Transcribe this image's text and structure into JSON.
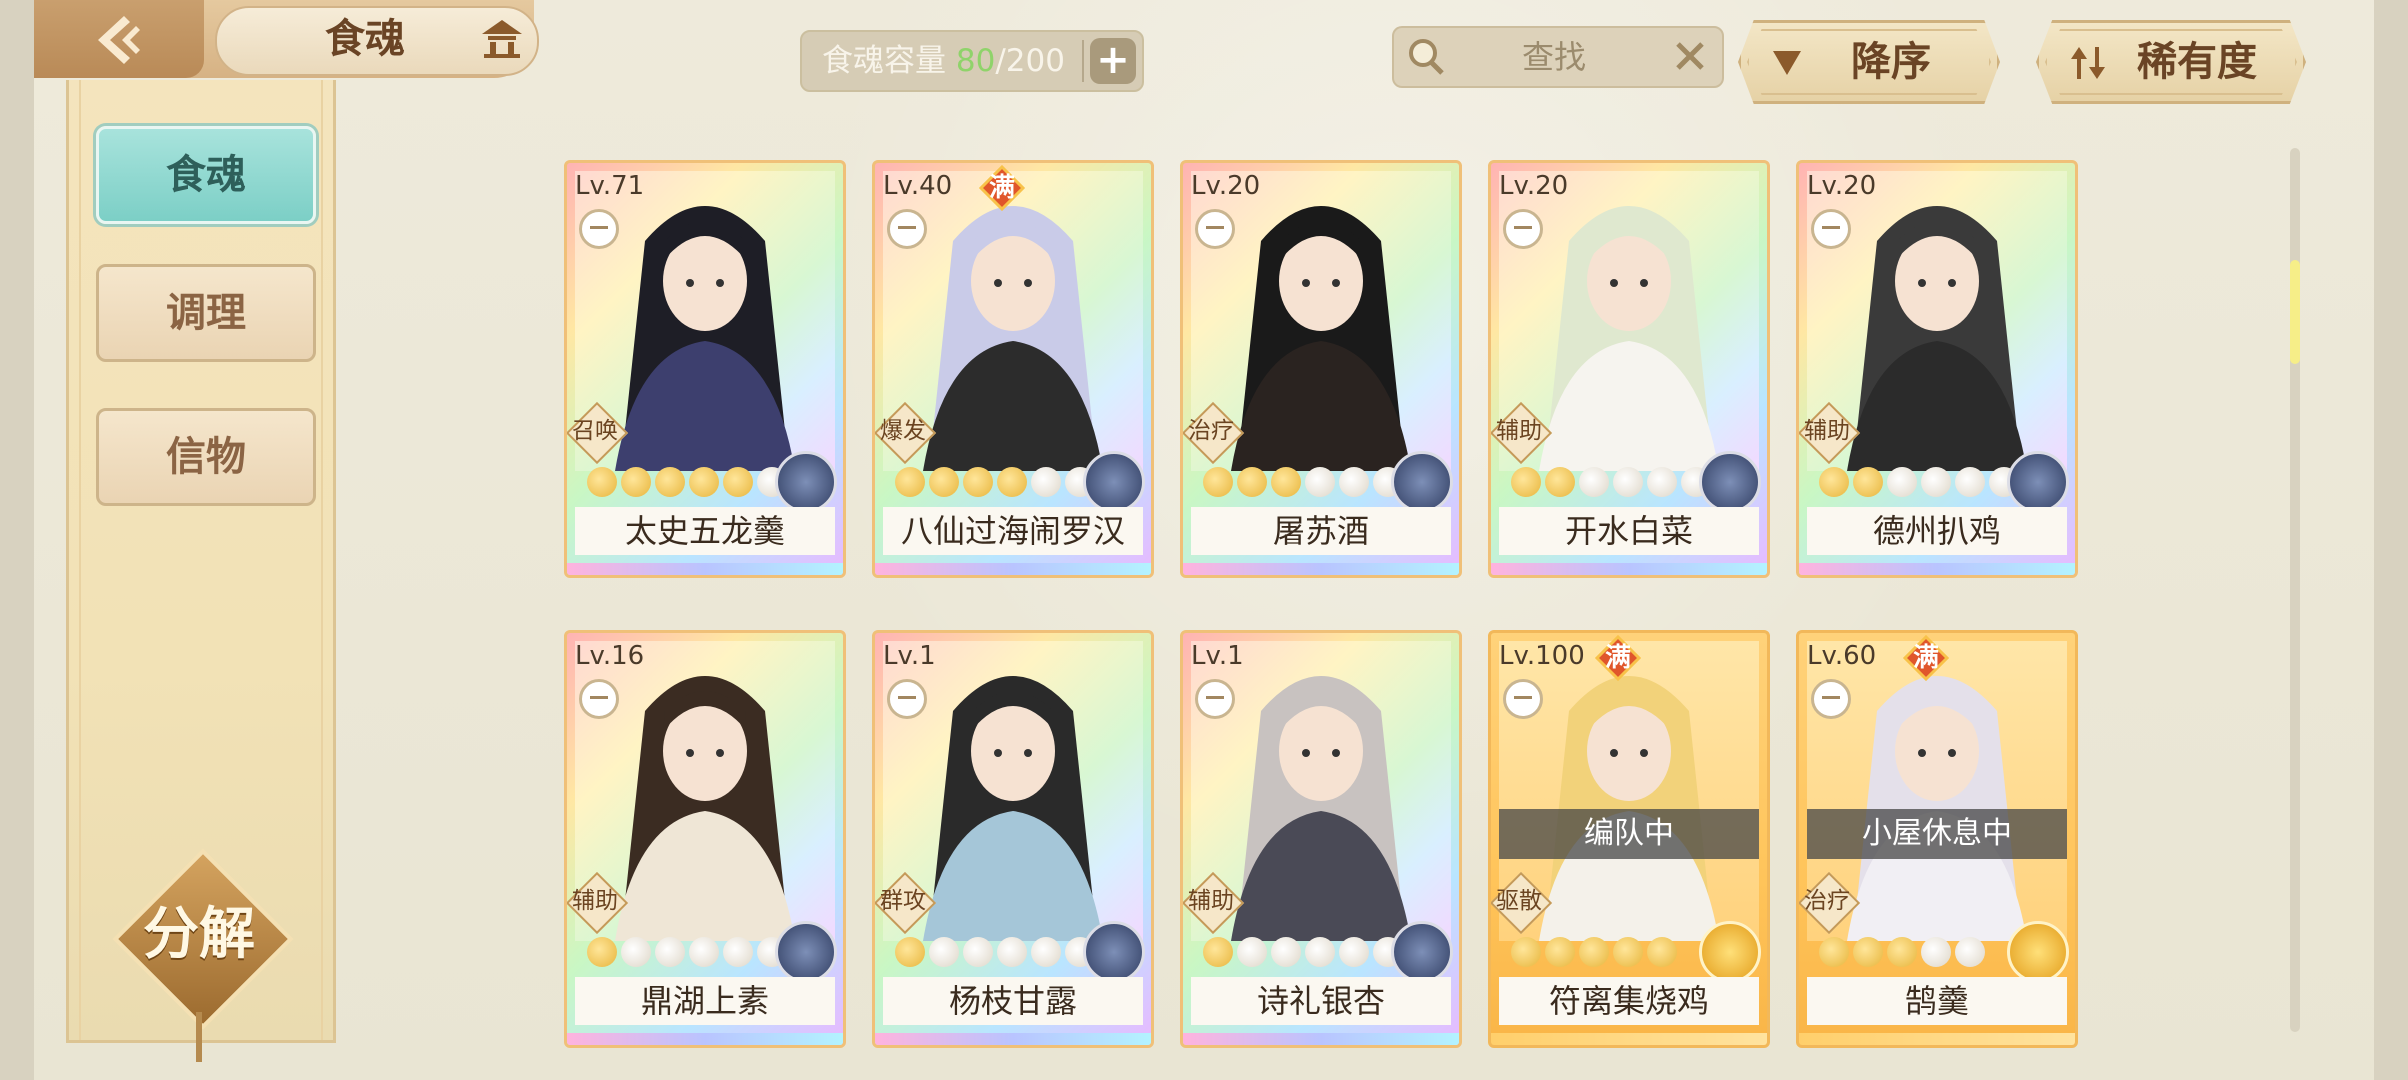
{
  "header": {
    "title": "食魂",
    "capacity": {
      "label": "食魂容量 ",
      "current": "80",
      "total": "/200"
    },
    "search": {
      "placeholder": "查找"
    },
    "sort_order_label": "降序",
    "sort_by_label": "稀有度"
  },
  "sidebar": {
    "items": [
      {
        "label": "食魂",
        "active": true
      },
      {
        "label": "调理",
        "active": false
      },
      {
        "label": "信物",
        "active": false
      }
    ],
    "decompose_label": "分解"
  },
  "cards": [
    {
      "level": "Lv.71",
      "name": "太史五龙羹",
      "role": "召唤",
      "full": false,
      "stars_on": 5,
      "stars_total": 6,
      "element": "blue",
      "frame": "rainbow",
      "status": ""
    },
    {
      "level": "Lv.40",
      "name": "八仙过海闹罗汉",
      "role": "爆发",
      "full": true,
      "full_label": "满",
      "stars_on": 4,
      "stars_total": 6,
      "element": "blue",
      "frame": "rainbow",
      "status": ""
    },
    {
      "level": "Lv.20",
      "name": "屠苏酒",
      "role": "治疗",
      "full": false,
      "stars_on": 3,
      "stars_total": 6,
      "element": "blue",
      "frame": "rainbow",
      "status": ""
    },
    {
      "level": "Lv.20",
      "name": "开水白菜",
      "role": "辅助",
      "full": false,
      "stars_on": 2,
      "stars_total": 6,
      "element": "blue",
      "frame": "rainbow",
      "status": ""
    },
    {
      "level": "Lv.20",
      "name": "德州扒鸡",
      "role": "辅助",
      "full": false,
      "stars_on": 2,
      "stars_total": 6,
      "element": "blue",
      "frame": "rainbow",
      "status": ""
    },
    {
      "level": "Lv.16",
      "name": "鼎湖上素",
      "role": "辅助",
      "full": false,
      "stars_on": 1,
      "stars_total": 6,
      "element": "blue",
      "frame": "rainbow",
      "status": ""
    },
    {
      "level": "Lv.1",
      "name": "杨枝甘露",
      "role": "群攻",
      "full": false,
      "stars_on": 1,
      "stars_total": 6,
      "element": "blue",
      "frame": "rainbow",
      "status": ""
    },
    {
      "level": "Lv.1",
      "name": "诗礼银杏",
      "role": "辅助",
      "full": false,
      "stars_on": 1,
      "stars_total": 6,
      "element": "blue",
      "frame": "rainbow",
      "status": ""
    },
    {
      "level": "Lv.100",
      "name": "符离集烧鸡",
      "role": "驱散",
      "full": true,
      "full_label": "满",
      "stars_on": 5,
      "stars_total": 5,
      "element": "gold",
      "frame": "gold",
      "status": "编队中"
    },
    {
      "level": "Lv.60",
      "name": "鹄羹",
      "role": "治疗",
      "full": true,
      "full_label": "满",
      "stars_on": 3,
      "stars_total": 5,
      "element": "gold",
      "frame": "gold",
      "status": "小屋休息中"
    }
  ],
  "colors": {
    "accent_teal": "#7ccfc6",
    "gold": "#e7b43a",
    "capacity_green": "#8fd36a"
  },
  "icons": [
    "back-arrow-icon",
    "home-icon",
    "add-icon",
    "search-icon",
    "close-icon",
    "triangle-down-icon",
    "sort-arrows-icon",
    "element-icon",
    "star-icon",
    "minus-icon"
  ]
}
